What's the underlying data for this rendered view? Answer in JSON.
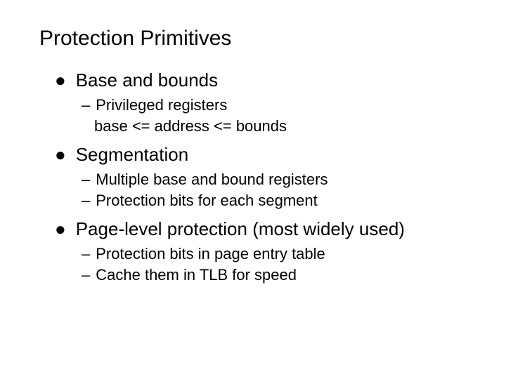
{
  "title": "Protection Primitives",
  "items": [
    {
      "label": "Base and bounds",
      "subs": [
        {
          "text": "Privileged registers",
          "cont": "base <= address <= bounds"
        }
      ]
    },
    {
      "label": "Segmentation",
      "subs": [
        {
          "text": "Multiple base and bound registers"
        },
        {
          "text": "Protection bits for each segment"
        }
      ]
    },
    {
      "label": "Page-level protection (most widely used)",
      "subs": [
        {
          "text": "Protection bits in page entry table"
        },
        {
          "text": "Cache them in TLB for speed"
        }
      ]
    }
  ]
}
